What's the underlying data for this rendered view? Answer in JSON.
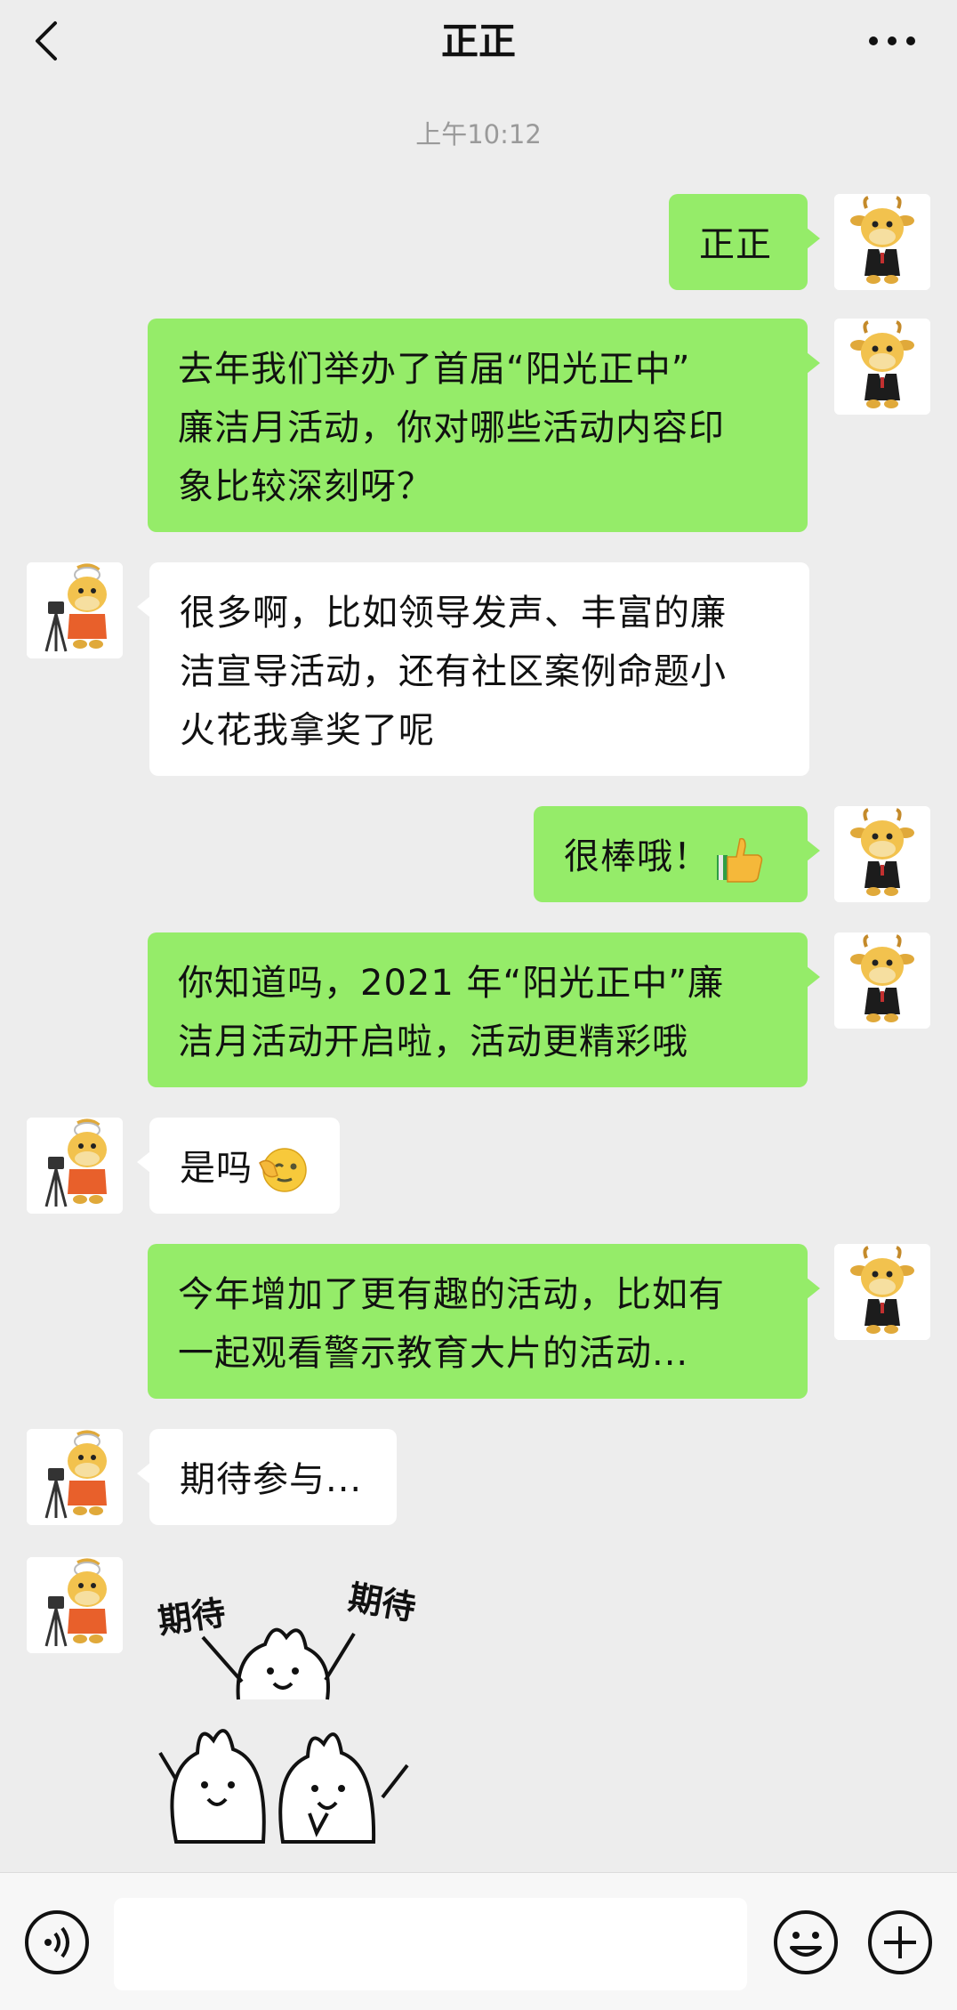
{
  "header": {
    "title": "正正",
    "back_icon": "chevron-left-icon",
    "more_icon": "more-dots-icon"
  },
  "timestamp": "上午10:12",
  "messages": [
    {
      "side": "right",
      "text": "正正"
    },
    {
      "side": "right",
      "lines": [
        "去年我们举办了首届“阳光正中”",
        "廉洁月活动，你对哪些活动内容印",
        "象比较深刻呀？"
      ]
    },
    {
      "side": "left",
      "lines": [
        "很多啊，比如领导发声、丰富的廉",
        "洁宣导活动，还有社区案例命题小",
        "火花我拿奖了呢"
      ]
    },
    {
      "side": "right",
      "text": "很棒哦！",
      "emoji": "thumbs-up-icon"
    },
    {
      "side": "right",
      "lines": [
        "你知道吗，2021 年“阳光正中”廉",
        "洁月活动开启啦，活动更精彩哦"
      ]
    },
    {
      "side": "left",
      "text": "是吗",
      "emoji": "wink-face-icon"
    },
    {
      "side": "right",
      "lines": [
        "今年增加了更有趣的活动，比如有",
        "一起观看警示教育大片的活动..."
      ]
    },
    {
      "side": "left",
      "text": "期待参与..."
    }
  ],
  "sticker": {
    "left_text": "期待",
    "right_text": "期待"
  },
  "input": {
    "placeholder": "",
    "voice_icon": "voice-icon",
    "emoji_icon": "smile-icon",
    "plus_icon": "plus-icon"
  },
  "colors": {
    "background": "#ededed",
    "bubble_self": "#95ec69",
    "bubble_other": "#ffffff",
    "timestamp": "#9a9a9a"
  }
}
